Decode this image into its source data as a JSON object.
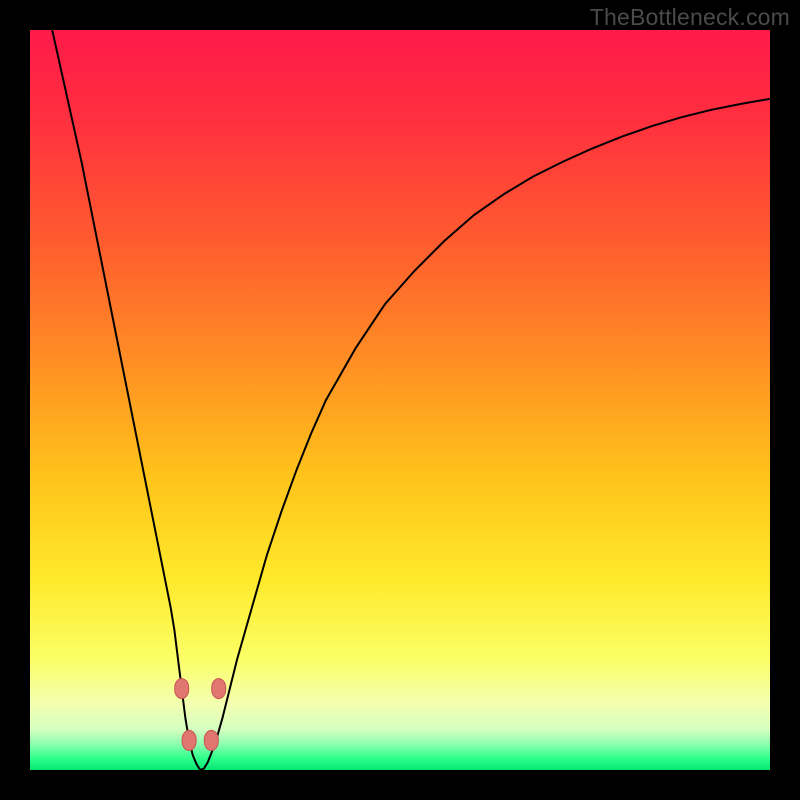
{
  "watermark": {
    "text": "TheBottleneck.com"
  },
  "colors": {
    "frame": "#000000",
    "curve": "#000000",
    "marker_fill": "#e07670",
    "marker_stroke": "#c9544f",
    "gradient_stops": [
      {
        "offset": 0.0,
        "color": "#ff1a4a"
      },
      {
        "offset": 0.12,
        "color": "#ff2f3f"
      },
      {
        "offset": 0.28,
        "color": "#ff5a2f"
      },
      {
        "offset": 0.45,
        "color": "#ff8f24"
      },
      {
        "offset": 0.6,
        "color": "#ffc21a"
      },
      {
        "offset": 0.74,
        "color": "#ffe92a"
      },
      {
        "offset": 0.85,
        "color": "#fbff66"
      },
      {
        "offset": 0.91,
        "color": "#f3ffb0"
      },
      {
        "offset": 0.945,
        "color": "#d6ffc0"
      },
      {
        "offset": 0.965,
        "color": "#8cffb0"
      },
      {
        "offset": 0.985,
        "color": "#2bff8a"
      },
      {
        "offset": 1.0,
        "color": "#07e472"
      }
    ]
  },
  "chart_data": {
    "type": "line",
    "title": "",
    "xlabel": "",
    "ylabel": "",
    "xlim": [
      0,
      100
    ],
    "ylim": [
      0,
      100
    ],
    "grid": false,
    "x": [
      3,
      4,
      5,
      6,
      7,
      8,
      9,
      10,
      11,
      12,
      13,
      14,
      15,
      16,
      17,
      18,
      19,
      19.5,
      20,
      20.5,
      21,
      21.5,
      22,
      22.5,
      23,
      23.5,
      24,
      25,
      26,
      27,
      28,
      30,
      32,
      34,
      36,
      38,
      40,
      44,
      48,
      52,
      56,
      60,
      64,
      68,
      72,
      76,
      80,
      84,
      88,
      92,
      96,
      100
    ],
    "values": [
      100,
      95.5,
      91,
      86.5,
      82,
      77,
      72,
      67,
      62,
      57,
      52,
      47,
      42,
      37,
      32,
      27,
      22,
      19,
      15,
      11,
      7,
      4,
      2,
      0.8,
      0,
      0.2,
      1,
      3.5,
      7,
      11,
      15,
      22,
      29,
      35,
      40.5,
      45.5,
      50,
      57,
      63,
      67.5,
      71.5,
      75,
      77.8,
      80.2,
      82.2,
      84,
      85.6,
      87,
      88.2,
      89.2,
      90,
      90.7
    ],
    "markers_x": [
      20.5,
      21.5,
      24.5,
      25.5
    ],
    "markers_y": [
      11,
      4,
      4,
      11
    ],
    "notch_x": 23,
    "legend": false
  }
}
